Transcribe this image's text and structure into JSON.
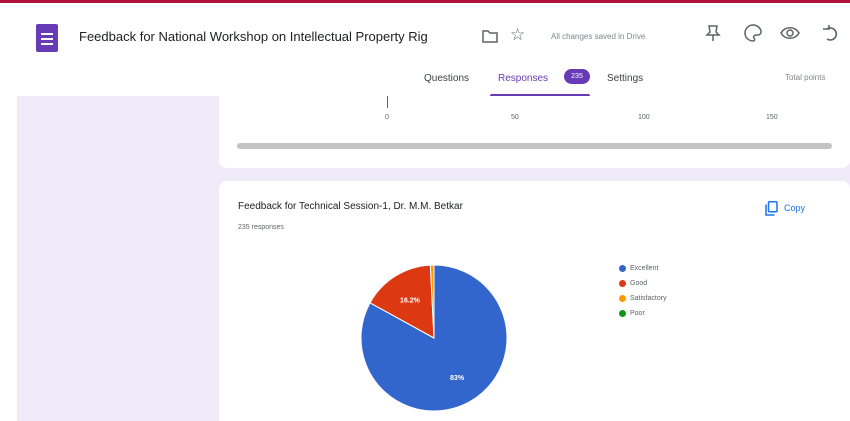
{
  "header": {
    "title": "Feedback  for National Workshop on Intellectual Property Rig",
    "save_status": "All changes saved in Drive",
    "total_points": "Total points"
  },
  "tabs": [
    {
      "label": "Questions"
    },
    {
      "label": "Responses",
      "badge": "235"
    },
    {
      "label": "Settings"
    }
  ],
  "prev_chart": {
    "ticks": [
      "0",
      "50",
      "100",
      "150"
    ]
  },
  "question": {
    "title": "Feedback for Technical Session-1, Dr. M.M. Betkar",
    "responses": "235 responses",
    "copy_label": "Copy"
  },
  "chart_data": {
    "type": "pie",
    "title": "Feedback for Technical Session-1, Dr. M.M. Betkar",
    "categories": [
      "Excellent",
      "Good",
      "Satisfactory",
      "Poor"
    ],
    "values": [
      83,
      16.2,
      0.8,
      0
    ],
    "slice_labels": [
      "83%",
      "16.2%",
      "",
      ""
    ],
    "colors": [
      "#3366cc",
      "#dc3912",
      "#ff9900",
      "#109618"
    ],
    "legend_position": "right"
  },
  "colors": {
    "accent": "#673ab7",
    "background": "#f0ebf8",
    "link": "#1a73e8"
  }
}
